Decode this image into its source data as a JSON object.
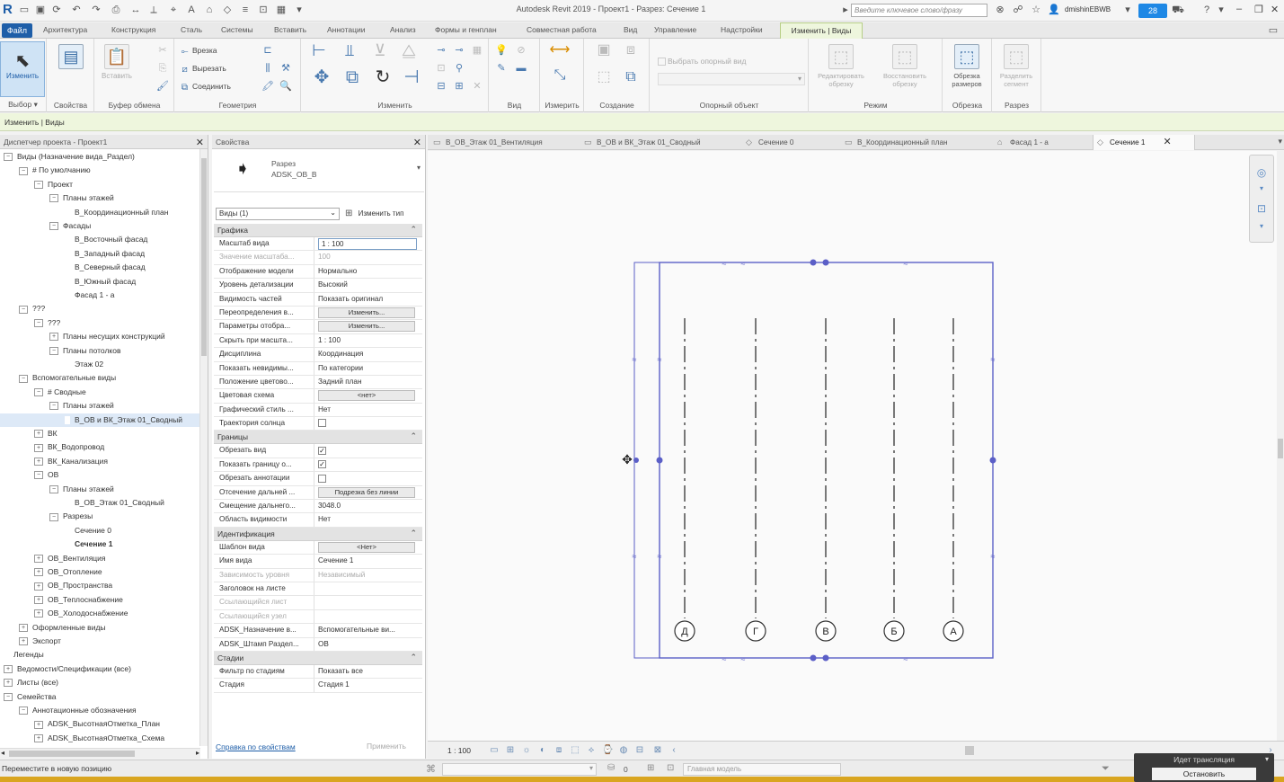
{
  "app": {
    "logo": "R",
    "title": "Autodesk Revit 2019 - Проект1 - Разрез: Сечение 1",
    "search_placeholder": "Введите ключевое слово/фразу",
    "user": "dmishinEBWB",
    "notifications": "28"
  },
  "ribbon_tabs": [
    "Файл",
    "Архитектура",
    "Конструкция",
    "Сталь",
    "Системы",
    "Вставить",
    "Аннотации",
    "Анализ",
    "Формы и генплан",
    "Совместная работа",
    "Вид",
    "Управление",
    "Надстройки",
    "Изменить | Виды"
  ],
  "ribbon": {
    "modify_label": "Изменить",
    "panels": [
      "Выбор ▾",
      "Свойства",
      "Буфер обмена",
      "Геометрия",
      "Изменить",
      "Вид",
      "Измерить",
      "Создание",
      "Опорный объект",
      "Режим",
      "Обрезка",
      "Разрез"
    ],
    "paste_label": "Вставить",
    "geometry_tools": [
      "Врезка",
      "Вырезать",
      "Соединить"
    ],
    "ref_plane_checkbox": "Выбрать опорный вид",
    "edit_crop": "Редактировать обрезку",
    "reset_crop": "Восстановить обрезку",
    "size_crop": "Обрезка размеров",
    "split_segment": "Разделить сегмент"
  },
  "context_bar": "Изменить | Виды",
  "browser": {
    "title": "Диспетчер проекта - Проект1",
    "items": [
      {
        "label": "Виды (Назначение вида_Раздел)",
        "level": 0,
        "toggle": "−"
      },
      {
        "label": "# По умолчанию",
        "level": 1,
        "toggle": "−"
      },
      {
        "label": "Проект",
        "level": 2,
        "toggle": "−"
      },
      {
        "label": "Планы этажей",
        "level": 3,
        "toggle": "−"
      },
      {
        "label": "В_Координационный план",
        "level": 4,
        "toggle": ""
      },
      {
        "label": "Фасады",
        "level": 3,
        "toggle": "−"
      },
      {
        "label": "В_Восточный фасад",
        "level": 4,
        "toggle": ""
      },
      {
        "label": "В_Западный фасад",
        "level": 4,
        "toggle": ""
      },
      {
        "label": "В_Северный фасад",
        "level": 4,
        "toggle": ""
      },
      {
        "label": "В_Южный фасад",
        "level": 4,
        "toggle": ""
      },
      {
        "label": "Фасад 1 - а",
        "level": 4,
        "toggle": ""
      },
      {
        "label": "???",
        "level": 1,
        "toggle": "−"
      },
      {
        "label": "???",
        "level": 2,
        "toggle": "−"
      },
      {
        "label": "Планы несущих конструкций",
        "level": 3,
        "toggle": "+"
      },
      {
        "label": "Планы потолков",
        "level": 3,
        "toggle": "−"
      },
      {
        "label": "Этаж 02",
        "level": 4,
        "toggle": ""
      },
      {
        "label": "Вспомогательные виды",
        "level": 1,
        "toggle": "−"
      },
      {
        "label": "# Сводные",
        "level": 2,
        "toggle": "−"
      },
      {
        "label": "Планы этажей",
        "level": 3,
        "toggle": "−"
      },
      {
        "label": "В_ОВ и ВК_Этаж 01_Сводный",
        "level": 4,
        "toggle": "",
        "selected": true
      },
      {
        "label": "ВК",
        "level": 2,
        "toggle": "+"
      },
      {
        "label": "ВК_Водопровод",
        "level": 2,
        "toggle": "+"
      },
      {
        "label": "ВК_Канализация",
        "level": 2,
        "toggle": "+"
      },
      {
        "label": "ОВ",
        "level": 2,
        "toggle": "−"
      },
      {
        "label": "Планы этажей",
        "level": 3,
        "toggle": "−"
      },
      {
        "label": "В_ОВ_Этаж 01_Сводный",
        "level": 4,
        "toggle": ""
      },
      {
        "label": "Разрезы",
        "level": 3,
        "toggle": "−"
      },
      {
        "label": "Сечение 0",
        "level": 4,
        "toggle": ""
      },
      {
        "label": "Сечение 1",
        "level": 4,
        "toggle": "",
        "bold": true
      },
      {
        "label": "ОВ_Вентиляция",
        "level": 2,
        "toggle": "+"
      },
      {
        "label": "ОВ_Отопление",
        "level": 2,
        "toggle": "+"
      },
      {
        "label": "ОВ_Пространства",
        "level": 2,
        "toggle": "+"
      },
      {
        "label": "ОВ_Теплоснабжение",
        "level": 2,
        "toggle": "+"
      },
      {
        "label": "ОВ_Холодоснабжение",
        "level": 2,
        "toggle": "+"
      },
      {
        "label": "Оформленные виды",
        "level": 1,
        "toggle": "+"
      },
      {
        "label": "Экспорт",
        "level": 1,
        "toggle": "+"
      },
      {
        "label": "Легенды",
        "level": 0,
        "toggle": ""
      },
      {
        "label": "Ведомости/Спецификации (все)",
        "level": 0,
        "toggle": "+"
      },
      {
        "label": "Листы (все)",
        "level": 0,
        "toggle": "+"
      },
      {
        "label": "Семейства",
        "level": 0,
        "toggle": "−"
      },
      {
        "label": "Аннотационные обозначения",
        "level": 1,
        "toggle": "−"
      },
      {
        "label": "ADSK_ВысотнаяОтметка_План",
        "level": 2,
        "toggle": "+"
      },
      {
        "label": "ADSK_ВысотнаяОтметка_Схема",
        "level": 2,
        "toggle": "+"
      }
    ]
  },
  "properties": {
    "title": "Свойства",
    "type_family": "Разрез",
    "type_name": "ADSK_ОВ_В",
    "instance_filter": "Виды (1)",
    "edit_type": "Изменить тип",
    "sections": [
      {
        "name": "Графика",
        "rows": [
          {
            "key": "Масштаб вида",
            "value": "1 : 100",
            "kind": "input"
          },
          {
            "key": "Значение масштаба...",
            "value": "100",
            "kind": "readonly"
          },
          {
            "key": "Отображение модели",
            "value": "Нормально"
          },
          {
            "key": "Уровень детализации",
            "value": "Высокий"
          },
          {
            "key": "Видимость частей",
            "value": "Показать оригинал"
          },
          {
            "key": "Переопределения в...",
            "value": "Изменить...",
            "kind": "button"
          },
          {
            "key": "Параметры отобра...",
            "value": "Изменить...",
            "kind": "button"
          },
          {
            "key": "Скрыть при масшта...",
            "value": "1 : 100"
          },
          {
            "key": "Дисциплина",
            "value": "Координация"
          },
          {
            "key": "Показать невидимы...",
            "value": "По категории"
          },
          {
            "key": "Положение цветово...",
            "value": "Задний план"
          },
          {
            "key": "Цветовая схема",
            "value": "<нет>",
            "kind": "button"
          },
          {
            "key": "Графический стиль ...",
            "value": "Нет"
          },
          {
            "key": "Траектория солнца",
            "value": "",
            "kind": "checkbox",
            "checked": false
          }
        ]
      },
      {
        "name": "Границы",
        "rows": [
          {
            "key": "Обрезать вид",
            "value": "",
            "kind": "checkbox",
            "checked": true
          },
          {
            "key": "Показать границу о...",
            "value": "",
            "kind": "checkbox",
            "checked": true
          },
          {
            "key": "Обрезать аннотации",
            "value": "",
            "kind": "checkbox",
            "checked": false
          },
          {
            "key": "Отсечение дальней ...",
            "value": "Подрезка без линии",
            "kind": "button"
          },
          {
            "key": "Смещение дальнего...",
            "value": "3048.0"
          },
          {
            "key": "Область видимости",
            "value": "Нет"
          }
        ]
      },
      {
        "name": "Идентификация",
        "rows": [
          {
            "key": "Шаблон вида",
            "value": "<Нет>",
            "kind": "button"
          },
          {
            "key": "Имя вида",
            "value": "Сечение 1"
          },
          {
            "key": "Зависимость уровня",
            "value": "Независимый",
            "kind": "readonly"
          },
          {
            "key": "Заголовок на листе",
            "value": ""
          },
          {
            "key": "Ссылающийся лист",
            "value": "",
            "kind": "readonly"
          },
          {
            "key": "Ссылающийся узел",
            "value": "",
            "kind": "readonly"
          },
          {
            "key": "ADSK_Назначение в...",
            "value": "Вспомогательные ви..."
          },
          {
            "key": "ADSK_Штамп Раздел...",
            "value": "ОВ"
          }
        ]
      },
      {
        "name": "Стадии",
        "rows": [
          {
            "key": "Фильтр по стадиям",
            "value": "Показать все"
          },
          {
            "key": "Стадия",
            "value": "Стадия 1"
          }
        ]
      }
    ],
    "help_link": "Справка по свойствам",
    "apply": "Применить"
  },
  "view_tabs": [
    {
      "label": "В_ОВ_Этаж 01_Вентиляция",
      "icon": "plan-view-icon"
    },
    {
      "label": "В_ОВ и ВК_Этаж 01_Сводный",
      "icon": "plan-view-icon"
    },
    {
      "label": "Сечение 0",
      "icon": "section-view-icon"
    },
    {
      "label": "В_Координационный план",
      "icon": "plan-view-icon"
    },
    {
      "label": "Фасад 1 - а",
      "icon": "elevation-view-icon"
    },
    {
      "label": "Сечение 1",
      "icon": "section-view-icon",
      "active": true
    }
  ],
  "grid_labels": [
    "Д",
    "Г",
    "В",
    "Б",
    "А"
  ],
  "view_control": {
    "scale": "1 : 100"
  },
  "status": {
    "text": "Переместите в новую позицию",
    "zero": "0",
    "model": "Главная модель"
  },
  "broadcast": {
    "label": "Идет трансляция",
    "stop": "Остановить"
  },
  "colors": {
    "accent": "#1e5ea8",
    "context": "#eef6dd",
    "crop_line": "#5b5fc7"
  }
}
